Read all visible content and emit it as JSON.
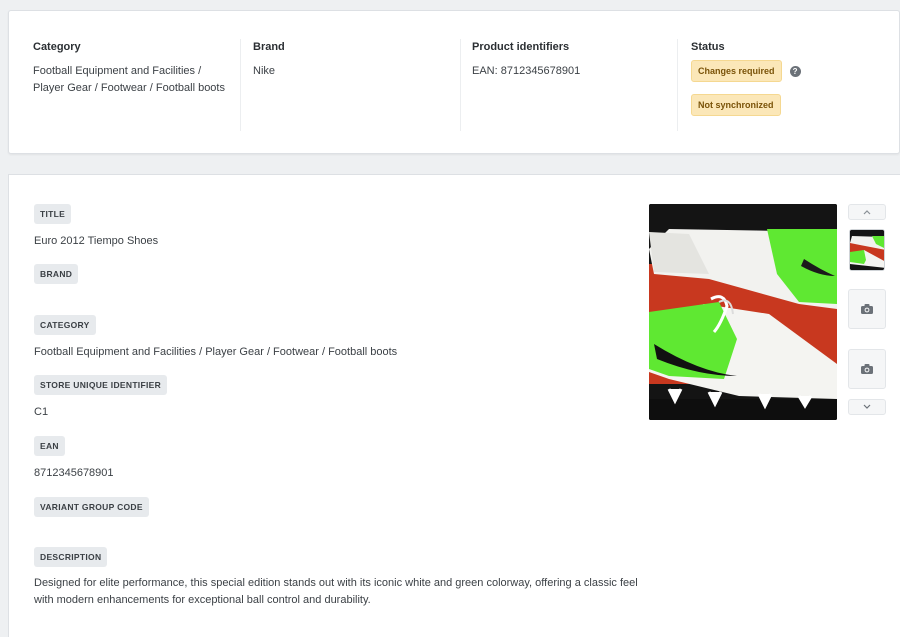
{
  "summary": {
    "category": {
      "title": "Category",
      "value": "Football Equipment and Facilities / Player Gear / Footwear / Football boots"
    },
    "brand": {
      "title": "Brand",
      "value": "Nike"
    },
    "identifiers": {
      "title": "Product identifiers",
      "value": "EAN: 8712345678901"
    },
    "status": {
      "title": "Status",
      "badge_1": "Changes required",
      "badge_2": "Not synchronized"
    }
  },
  "fields": {
    "title_label": "TITLE",
    "title_value": "Euro 2012 Tiempo Shoes",
    "brand_label": "BRAND",
    "category_label": "CATEGORY",
    "category_value": "Football Equipment and Facilities / Player Gear / Footwear / Football boots",
    "store_id_label": "STORE UNIQUE IDENTIFIER",
    "store_id_value": "C1",
    "ean_label": "EAN",
    "ean_value": "8712345678901",
    "variant_label": "VARIANT GROUP CODE",
    "description_label": "DESCRIPTION",
    "description_value": "Designed for elite performance, this special edition stands out with its iconic white and green colorway, offering a classic feel with modern enhancements for exceptional ball control and durability."
  },
  "icons": {
    "help": "question-circle-icon",
    "camera": "camera-icon",
    "up": "chevron-up-icon",
    "down": "chevron-down-icon"
  },
  "colors": {
    "badge_bg": "#fbe7b8",
    "badge_text": "#7a5309",
    "label_bg": "#e7eaed",
    "shoe_green": "#5fe832"
  }
}
